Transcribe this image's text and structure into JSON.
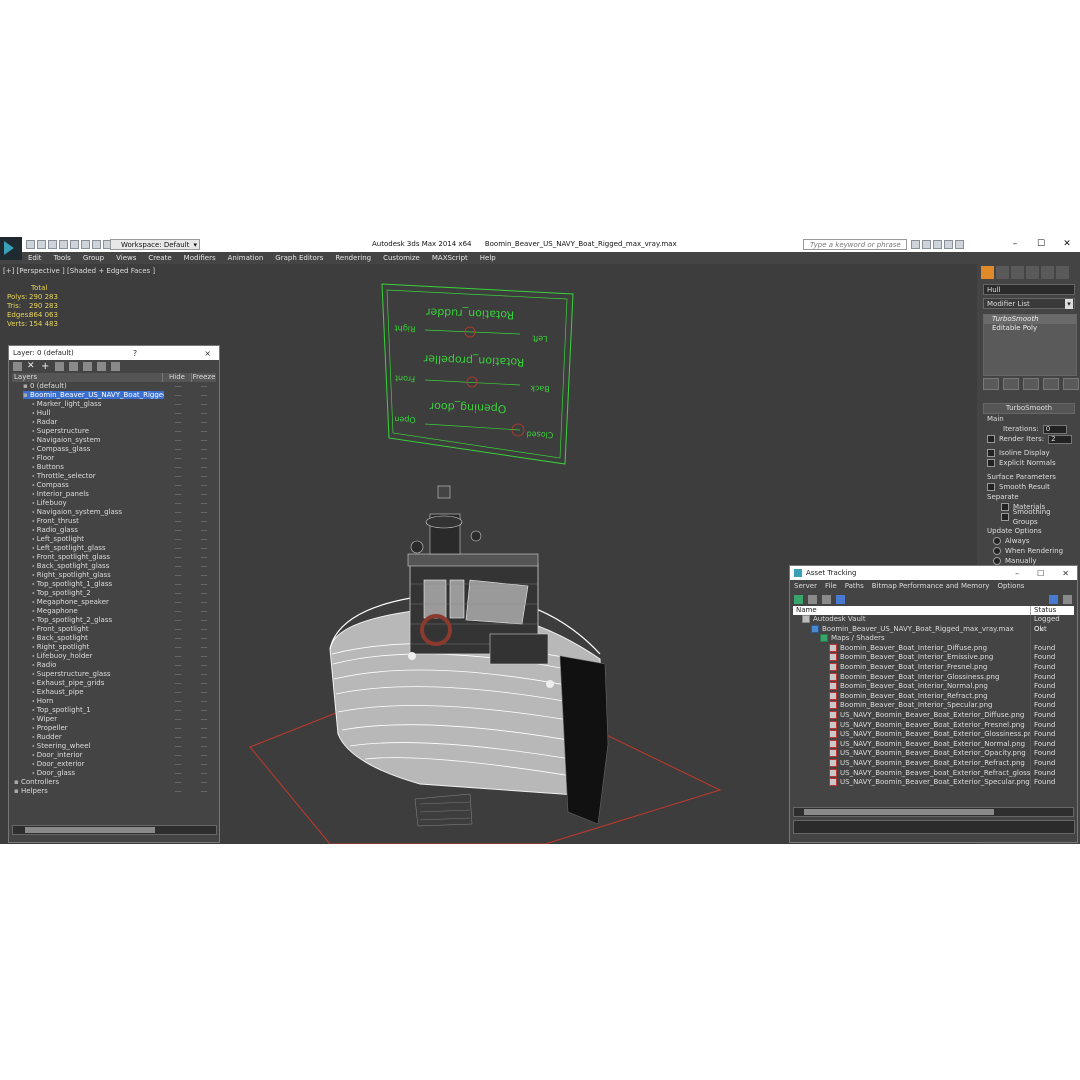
{
  "titlebar": {
    "workspace": "Workspace: Default",
    "app_title": "Autodesk 3ds Max 2014 x64",
    "file_name": "Boomin_Beaver_US_NAVY_Boat_Rigged_max_vray.max",
    "search_placeholder": "Type a keyword or phrase",
    "help_icon": "?"
  },
  "menu": [
    "Edit",
    "Tools",
    "Group",
    "Views",
    "Create",
    "Modifiers",
    "Animation",
    "Graph Editors",
    "Rendering",
    "Customize",
    "MAXScript",
    "Help"
  ],
  "viewport": {
    "label": "[+] [Perspective ] [Shaded + Edged Faces ]",
    "stats": {
      "header": "Total",
      "rows": [
        {
          "k": "Polys:",
          "v": "290 283"
        },
        {
          "k": "Tris:",
          "v": "290 283"
        },
        {
          "k": "Edges:",
          "v": "864 063"
        },
        {
          "k": "Verts:",
          "v": "154 483"
        }
      ]
    },
    "rig_panel": {
      "rows": [
        {
          "title": "Rotation_rudder",
          "left": "Right",
          "right": "Left"
        },
        {
          "title": "Rotation_propeller",
          "left": "Front",
          "right": "Back"
        },
        {
          "title": "Opening_door",
          "left": "Open",
          "right": "Closed"
        }
      ]
    }
  },
  "command_panel": {
    "object_name": "Hull",
    "modifier_list": "Modifier List",
    "stack": [
      "TurboSmooth",
      "Editable Poly"
    ],
    "rollout_title": "TurboSmooth",
    "main_label": "Main",
    "iterations_label": "Iterations:",
    "iterations_value": "0",
    "render_iters_label": "Render Iters:",
    "render_iters_value": "2",
    "isoline": "Isoline Display",
    "explicit": "Explicit Normals",
    "surface_params": "Surface Parameters",
    "smooth_result": "Smooth Result",
    "separate": "Separate",
    "materials": "Materials",
    "smoothing_groups": "Smoothing Groups",
    "update_options": "Update Options",
    "always": "Always",
    "when_rendering": "When Rendering",
    "manually": "Manually"
  },
  "layers": {
    "title": "Layer: 0 (default)",
    "help": "?",
    "close": "×",
    "col_layers": "Layers",
    "col_hide": "Hide",
    "col_freeze": "Freeze",
    "items": [
      {
        "name": "0 (default)",
        "indent": 1
      },
      {
        "name": "Boomin_Beaver_US_NAVY_Boat_Rigged",
        "indent": 1,
        "selected": true
      },
      {
        "name": "Marker_light_glass",
        "indent": 2
      },
      {
        "name": "Hull",
        "indent": 2
      },
      {
        "name": "Radar",
        "indent": 2
      },
      {
        "name": "Superstructure",
        "indent": 2
      },
      {
        "name": "Navigaion_system",
        "indent": 2
      },
      {
        "name": "Compass_glass",
        "indent": 2
      },
      {
        "name": "Floor",
        "indent": 2
      },
      {
        "name": "Buttons",
        "indent": 2
      },
      {
        "name": "Throttle_selector",
        "indent": 2
      },
      {
        "name": "Compass",
        "indent": 2
      },
      {
        "name": "Interior_panels",
        "indent": 2
      },
      {
        "name": "Lifebuoy",
        "indent": 2
      },
      {
        "name": "Navigaion_system_glass",
        "indent": 2
      },
      {
        "name": "Front_thrust",
        "indent": 2
      },
      {
        "name": "Radio_glass",
        "indent": 2
      },
      {
        "name": "Left_spotlight",
        "indent": 2
      },
      {
        "name": "Left_spotlight_glass",
        "indent": 2
      },
      {
        "name": "Front_spotlight_glass",
        "indent": 2
      },
      {
        "name": "Back_spotlight_glass",
        "indent": 2
      },
      {
        "name": "Right_spotlight_glass",
        "indent": 2
      },
      {
        "name": "Top_spotlight_1_glass",
        "indent": 2
      },
      {
        "name": "Top_spotlight_2",
        "indent": 2
      },
      {
        "name": "Megaphone_speaker",
        "indent": 2
      },
      {
        "name": "Megaphone",
        "indent": 2
      },
      {
        "name": "Top_spotlight_2_glass",
        "indent": 2
      },
      {
        "name": "Front_spotlight",
        "indent": 2
      },
      {
        "name": "Back_spotlight",
        "indent": 2
      },
      {
        "name": "Right_spotlight",
        "indent": 2
      },
      {
        "name": "Lifebuoy_holder",
        "indent": 2
      },
      {
        "name": "Radio",
        "indent": 2
      },
      {
        "name": "Superstructure_glass",
        "indent": 2
      },
      {
        "name": "Exhaust_pipe_grids",
        "indent": 2
      },
      {
        "name": "Exhaust_pipe",
        "indent": 2
      },
      {
        "name": "Horn",
        "indent": 2
      },
      {
        "name": "Top_spotlight_1",
        "indent": 2
      },
      {
        "name": "Wiper",
        "indent": 2
      },
      {
        "name": "Propeller",
        "indent": 2
      },
      {
        "name": "Rudder",
        "indent": 2
      },
      {
        "name": "Steering_wheel",
        "indent": 2
      },
      {
        "name": "Door_interior",
        "indent": 2
      },
      {
        "name": "Door_exterior",
        "indent": 2
      },
      {
        "name": "Door_glass",
        "indent": 2
      },
      {
        "name": "Controllers",
        "indent": 0
      },
      {
        "name": "Helpers",
        "indent": 0
      }
    ]
  },
  "asset_tracking": {
    "title": "Asset Tracking",
    "menu": [
      "Server",
      "File",
      "Paths",
      "Bitmap Performance and Memory",
      "Options"
    ],
    "col_name": "Name",
    "col_status": "Status",
    "rows": [
      {
        "name": "Autodesk Vault",
        "status": "Logged Out",
        "indent": 1
      },
      {
        "name": "Boomin_Beaver_US_NAVY_Boat_Rigged_max_vray.max",
        "status": "Ok",
        "indent": 2
      },
      {
        "name": "Maps / Shaders",
        "status": "",
        "indent": 3
      },
      {
        "name": "Boomin_Beaver_Boat_Interior_Diffuse.png",
        "status": "Found",
        "indent": 4
      },
      {
        "name": "Boomin_Beaver_Boat_Interior_Emissive.png",
        "status": "Found",
        "indent": 4
      },
      {
        "name": "Boomin_Beaver_Boat_Interior_Fresnel.png",
        "status": "Found",
        "indent": 4
      },
      {
        "name": "Boomin_Beaver_Boat_Interior_Glossiness.png",
        "status": "Found",
        "indent": 4
      },
      {
        "name": "Boomin_Beaver_Boat_Interior_Normal.png",
        "status": "Found",
        "indent": 4
      },
      {
        "name": "Boomin_Beaver_Boat_Interior_Refract.png",
        "status": "Found",
        "indent": 4
      },
      {
        "name": "Boomin_Beaver_Boat_Interior_Specular.png",
        "status": "Found",
        "indent": 4
      },
      {
        "name": "US_NAVY_Boomin_Beaver_Boat_Exterior_Diffuse.png",
        "status": "Found",
        "indent": 4
      },
      {
        "name": "US_NAVY_Boomin_Beaver_Boat_Exterior_Fresnel.png",
        "status": "Found",
        "indent": 4
      },
      {
        "name": "US_NAVY_Boomin_Beaver_Boat_Exterior_Glossiness.png",
        "status": "Found",
        "indent": 4
      },
      {
        "name": "US_NAVY_Boomin_Beaver_Boat_Exterior_Normal.png",
        "status": "Found",
        "indent": 4
      },
      {
        "name": "US_NAVY_Boomin_Beaver_Boat_Exterior_Opacity.png",
        "status": "Found",
        "indent": 4
      },
      {
        "name": "US_NAVY_Boomin_Beaver_Boat_Exterior_Refract.png",
        "status": "Found",
        "indent": 4
      },
      {
        "name": "US_NAVY_Boomin_Beaver_boat_Exterior_Refract_glossiness.png",
        "status": "Found",
        "indent": 4
      },
      {
        "name": "US_NAVY_Boomin_Beaver_Boat_Exterior_Specular.png",
        "status": "Found",
        "indent": 4
      }
    ]
  },
  "colors": {
    "wire": "#e8e8e8",
    "rig_green": "#39d23a",
    "grid_red": "#c0392b",
    "stats_yellow": "#e9d45a",
    "selection_blue": "#3a6fd0"
  }
}
